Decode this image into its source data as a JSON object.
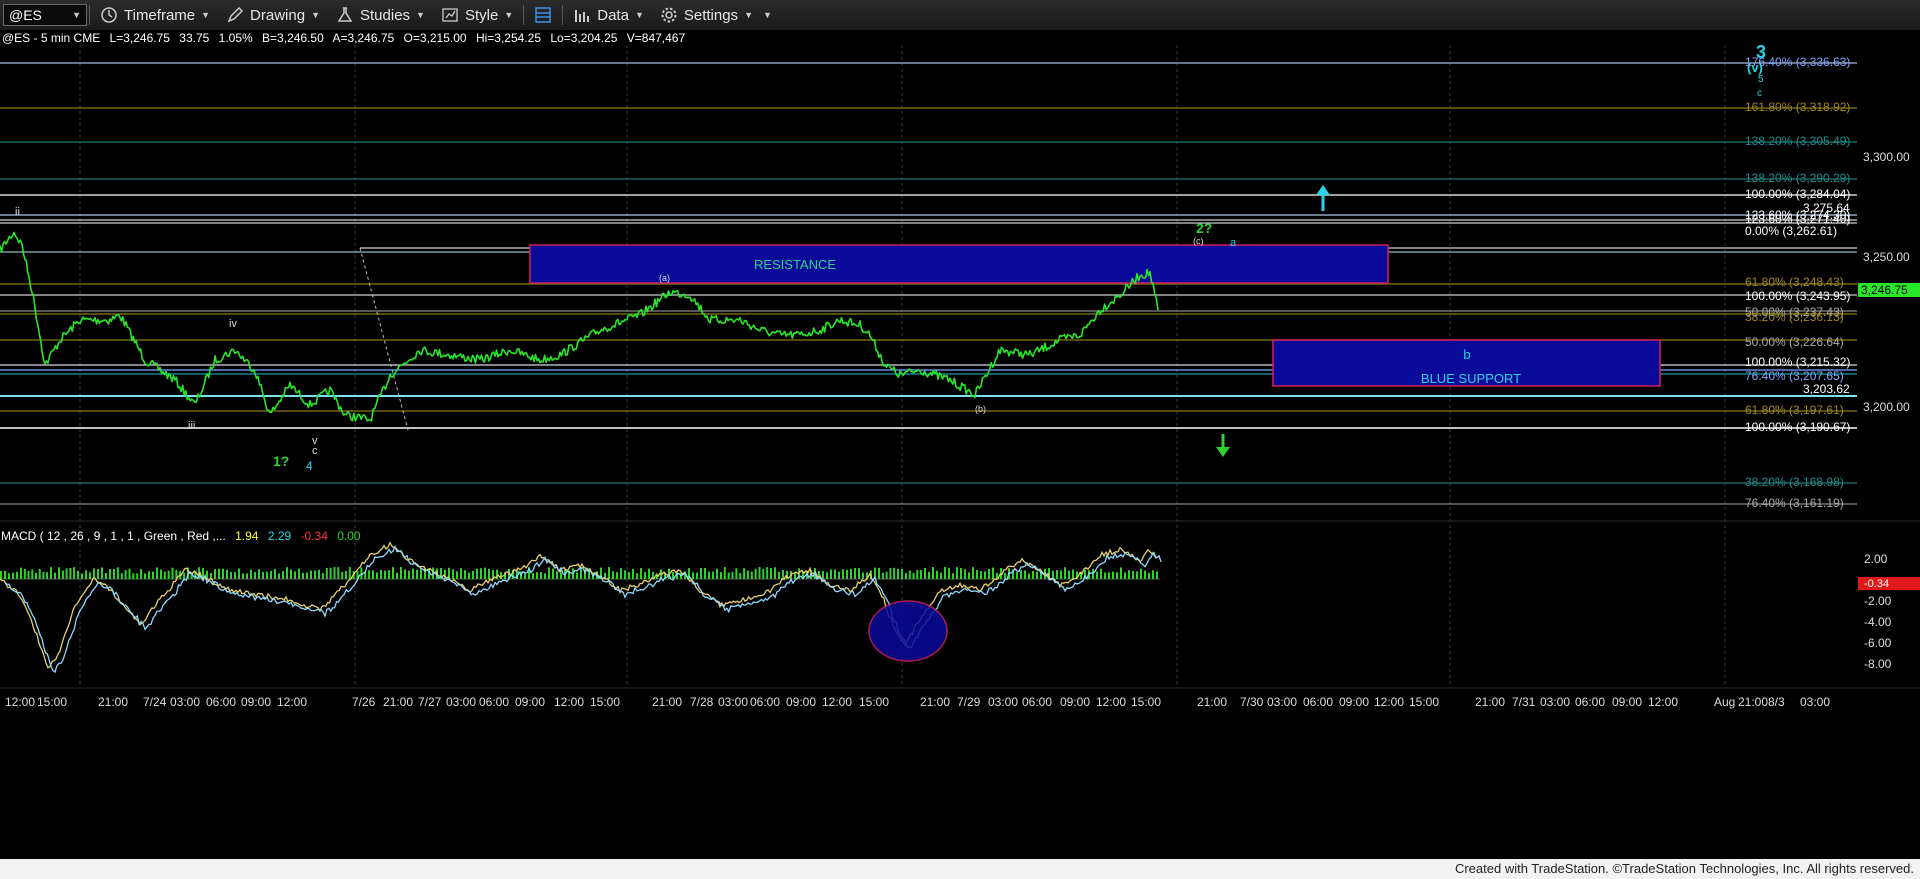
{
  "toolbar": {
    "symbol": "@ES",
    "timeframe_label": "Timeframe",
    "drawing_label": "Drawing",
    "studies_label": "Studies",
    "style_label": "Style",
    "data_label": "Data",
    "settings_label": "Settings",
    "icons": [
      "clock-icon",
      "pencil-icon",
      "flask-icon",
      "chart-style-icon",
      "layout-icon",
      "data-bars-icon",
      "gear-icon"
    ]
  },
  "header": {
    "symbol_line": "@ES - 5 min  CME",
    "last": "L=3,246.75",
    "change": "33.75",
    "change_pct": "1.05%",
    "bid": "B=3,246.50",
    "ask": "A=3,246.75",
    "open": "O=3,215.00",
    "high": "Hi=3,254.25",
    "low": "Lo=3,204.25",
    "volume": "V=847,467"
  },
  "macd": {
    "label": "MACD ( 12 , 26 , 9 , 1 , 1 , Green , Red ,...",
    "v1": "1.94",
    "v2": "2.29",
    "v3": "-0.34",
    "v4": "0.00"
  },
  "price_axis": {
    "labels": [
      "3,300.00",
      "3,250.00",
      "3,200.00"
    ],
    "current": "3,246.75"
  },
  "macd_axis": {
    "labels": [
      "2.00",
      "-2.00",
      "-4.00",
      "-6.00",
      "-8.00"
    ],
    "current": "-0.34"
  },
  "time_axis": [
    "12:00",
    "15:00",
    "21:00",
    "7/24",
    "03:00",
    "06:00",
    "09:00",
    "12:00",
    "7/26",
    "21:00",
    "7/27",
    "03:00",
    "06:00",
    "09:00",
    "12:00",
    "15:00",
    "21:00",
    "7/28",
    "03:00",
    "06:00",
    "09:00",
    "12:00",
    "15:00",
    "21:00",
    "7/29",
    "03:00",
    "06:00",
    "09:00",
    "12:00",
    "15:00",
    "21:00",
    "7/30",
    "03:00",
    "06:00",
    "09:00",
    "12:00",
    "15:00",
    "21:00",
    "7/31",
    "03:00",
    "06:00",
    "09:00",
    "12:00",
    "Aug",
    "21:00",
    "8/3",
    "03:00"
  ],
  "fib_labels": [
    {
      "text": "176.40% (3,336.63)",
      "color": "#7fa3ff"
    },
    {
      "text": "161.80% (3,318.92)",
      "color": "#a08a1a"
    },
    {
      "text": "138.20% (3,305.49)",
      "color": "#1f8d8d"
    },
    {
      "text": "138.20% (3,290.29)",
      "color": "#1f8d8d"
    },
    {
      "text": "100.00% (3,284.04)",
      "color": "#ffffff"
    },
    {
      "text": "3,275.64",
      "color": "#ffffff"
    },
    {
      "text": "123.60% (3,274.30)",
      "color": "#ffffff"
    },
    {
      "text": "123.60% (3,271.40)",
      "color": "#ffffff"
    },
    {
      "text": "0.00% (3,262.61)",
      "color": "#ffffff"
    },
    {
      "text": "61.80% (3,248.43)",
      "color": "#a08a1a"
    },
    {
      "text": "100.00% (3,243.95)",
      "color": "#ffffff"
    },
    {
      "text": "50.00% (3,237.43)",
      "color": "#aaaaaa"
    },
    {
      "text": "38.20% (3,236.13)",
      "color": "#a08a1a"
    },
    {
      "text": "50.00% (3,226.64)",
      "color": "#aaaaaa"
    },
    {
      "text": "100.00% (3,215.32)",
      "color": "#ffffff"
    },
    {
      "text": "76.40% (3,207.65)",
      "color": "#7fa3ff"
    },
    {
      "text": "3,203.62",
      "color": "#ffffff"
    },
    {
      "text": "61.80% (3,197.61)",
      "color": "#a08a1a"
    },
    {
      "text": "100.00% (3,190.67)",
      "color": "#ffffff"
    },
    {
      "text": "38.20% (3,168.98)",
      "color": "#1f8d8d"
    },
    {
      "text": "76.40% (3,161.19)",
      "color": "#aaaaaa"
    }
  ],
  "zones": {
    "resistance": "RESISTANCE",
    "support": "BLUE SUPPORT",
    "support_wave": "b"
  },
  "wave_labels": {
    "ii": "ii",
    "iii": "iii",
    "iv": "iv",
    "v": "v",
    "c": "c",
    "one_q": "1?",
    "four": "4",
    "a_paren": "(a)",
    "b_paren": "(b)",
    "c_paren": "(c)",
    "two_q": "2?",
    "a": "a",
    "three": "3",
    "v_paren": "(v)",
    "five": "5",
    "c_top": "c"
  },
  "footer": "Created with TradeStation. ©TradeStation Technologies, Inc. All rights reserved.",
  "colors": {
    "price": "#29e629",
    "bg": "#000000",
    "zone_fill": "#0a0a9a",
    "zone_border": "#d02060",
    "cyan": "#29d4e6",
    "green": "#2fd12f",
    "macd_neg": "#e01a1a"
  }
}
